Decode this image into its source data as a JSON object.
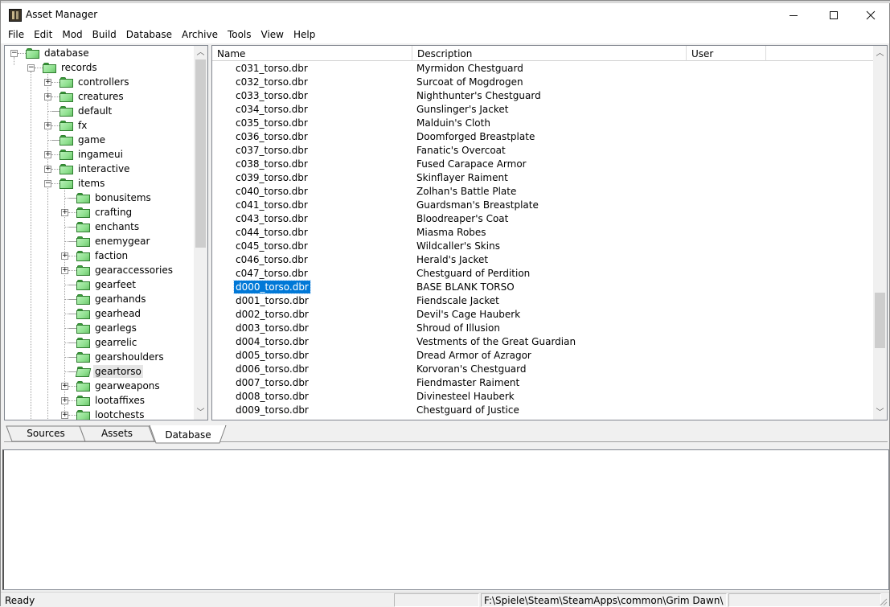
{
  "window": {
    "title": "Asset Manager",
    "icon": "asset-manager-app-icon",
    "controls": {
      "minimize": "—",
      "maximize": "☐",
      "close": "✕"
    }
  },
  "menubar": {
    "items": [
      "File",
      "Edit",
      "Mod",
      "Build",
      "Database",
      "Archive",
      "Tools",
      "View",
      "Help"
    ]
  },
  "tree": {
    "nodes": [
      {
        "label": "database",
        "level": 0,
        "expander": "minus"
      },
      {
        "label": "records",
        "level": 1,
        "expander": "minus"
      },
      {
        "label": "controllers",
        "level": 2,
        "expander": "plus"
      },
      {
        "label": "creatures",
        "level": 2,
        "expander": "plus"
      },
      {
        "label": "default",
        "level": 2,
        "expander": "none"
      },
      {
        "label": "fx",
        "level": 2,
        "expander": "plus"
      },
      {
        "label": "game",
        "level": 2,
        "expander": "none"
      },
      {
        "label": "ingameui",
        "level": 2,
        "expander": "plus"
      },
      {
        "label": "interactive",
        "level": 2,
        "expander": "plus"
      },
      {
        "label": "items",
        "level": 2,
        "expander": "minus"
      },
      {
        "label": "bonusitems",
        "level": 3,
        "expander": "none"
      },
      {
        "label": "crafting",
        "level": 3,
        "expander": "plus"
      },
      {
        "label": "enchants",
        "level": 3,
        "expander": "none"
      },
      {
        "label": "enemygear",
        "level": 3,
        "expander": "none"
      },
      {
        "label": "faction",
        "level": 3,
        "expander": "plus"
      },
      {
        "label": "gearaccessories",
        "level": 3,
        "expander": "plus"
      },
      {
        "label": "gearfeet",
        "level": 3,
        "expander": "none"
      },
      {
        "label": "gearhands",
        "level": 3,
        "expander": "none"
      },
      {
        "label": "gearhead",
        "level": 3,
        "expander": "none"
      },
      {
        "label": "gearlegs",
        "level": 3,
        "expander": "none"
      },
      {
        "label": "gearrelic",
        "level": 3,
        "expander": "none"
      },
      {
        "label": "gearshoulders",
        "level": 3,
        "expander": "none"
      },
      {
        "label": "geartorso",
        "level": 3,
        "expander": "none",
        "selected": true,
        "open": true
      },
      {
        "label": "gearweapons",
        "level": 3,
        "expander": "plus"
      },
      {
        "label": "lootaffixes",
        "level": 3,
        "expander": "plus"
      },
      {
        "label": "lootchests",
        "level": 3,
        "expander": "plus"
      }
    ]
  },
  "list": {
    "columns": [
      "Name",
      "Description",
      "User",
      ""
    ],
    "rows": [
      {
        "name": "c031_torso.dbr",
        "description": "Myrmidon Chestguard"
      },
      {
        "name": "c032_torso.dbr",
        "description": "Surcoat of Mogdrogen"
      },
      {
        "name": "c033_torso.dbr",
        "description": "Nighthunter's Chestguard"
      },
      {
        "name": "c034_torso.dbr",
        "description": "Gunslinger's Jacket"
      },
      {
        "name": "c035_torso.dbr",
        "description": "Malduin's Cloth"
      },
      {
        "name": "c036_torso.dbr",
        "description": "Doomforged Breastplate"
      },
      {
        "name": "c037_torso.dbr",
        "description": "Fanatic's Overcoat"
      },
      {
        "name": "c038_torso.dbr",
        "description": "Fused Carapace Armor"
      },
      {
        "name": "c039_torso.dbr",
        "description": "Skinflayer Raiment"
      },
      {
        "name": "c040_torso.dbr",
        "description": "Zolhan's Battle Plate"
      },
      {
        "name": "c041_torso.dbr",
        "description": "Guardsman's Breastplate"
      },
      {
        "name": "c043_torso.dbr",
        "description": "Bloodreaper's Coat"
      },
      {
        "name": "c044_torso.dbr",
        "description": "Miasma Robes"
      },
      {
        "name": "c045_torso.dbr",
        "description": "Wildcaller's Skins"
      },
      {
        "name": "c046_torso.dbr",
        "description": "Herald's Jacket"
      },
      {
        "name": "c047_torso.dbr",
        "description": "Chestguard of Perdition"
      },
      {
        "name": "d000_torso.dbr",
        "description": "BASE BLANK TORSO",
        "selected": true
      },
      {
        "name": "d001_torso.dbr",
        "description": "Fiendscale Jacket"
      },
      {
        "name": "d002_torso.dbr",
        "description": "Devil's Cage Hauberk"
      },
      {
        "name": "d003_torso.dbr",
        "description": "Shroud of Illusion"
      },
      {
        "name": "d004_torso.dbr",
        "description": "Vestments of the Great Guardian"
      },
      {
        "name": "d005_torso.dbr",
        "description": "Dread Armor of Azragor"
      },
      {
        "name": "d006_torso.dbr",
        "description": "Korvoran's Chestguard"
      },
      {
        "name": "d007_torso.dbr",
        "description": "Fiendmaster Raiment"
      },
      {
        "name": "d008_torso.dbr",
        "description": "Divinesteel Hauberk"
      },
      {
        "name": "d009_torso.dbr",
        "description": "Chestguard of Justice"
      }
    ]
  },
  "tabs": [
    {
      "label": "Sources",
      "active": false
    },
    {
      "label": "Assets",
      "active": false
    },
    {
      "label": "Database",
      "active": true
    }
  ],
  "output": {
    "text": ""
  },
  "statusbar": {
    "status": "Ready",
    "panel1": "",
    "path": "F:\\Spiele\\Steam\\SteamApps\\common\\Grim Dawn\\",
    "panel3": ""
  },
  "colors": {
    "selection": "#0078d7",
    "folder": "#8fe08f",
    "tree_selection": "#e5e5e5"
  }
}
